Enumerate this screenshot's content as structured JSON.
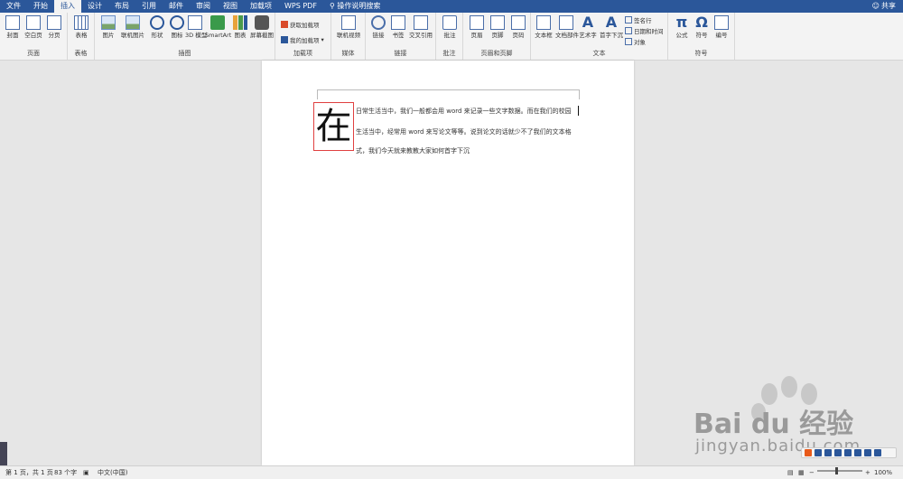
{
  "tabs": [
    "文件",
    "开始",
    "插入",
    "设计",
    "布局",
    "引用",
    "邮件",
    "审阅",
    "视图",
    "加载项",
    "WPS PDF",
    "操作说明搜索"
  ],
  "active_tab": "插入",
  "share_label": "共享",
  "ribbon": {
    "groups": {
      "pages": {
        "label": "页面",
        "buttons": [
          "封面",
          "空白页",
          "分页"
        ]
      },
      "tables": {
        "label": "表格",
        "buttons": [
          "表格"
        ]
      },
      "illustrations": {
        "label": "插图",
        "buttons": [
          "图片",
          "联机图片",
          "形状",
          "图标",
          "3D 模型",
          "SmartArt",
          "图表",
          "屏幕截图"
        ]
      },
      "addins": {
        "label": "加载项",
        "buttons": [
          "获取加载项",
          "我的加载项"
        ]
      },
      "media": {
        "label": "媒体",
        "buttons": [
          "联机视频"
        ]
      },
      "links": {
        "label": "链接",
        "buttons": [
          "链接",
          "书签",
          "交叉引用"
        ]
      },
      "comments": {
        "label": "批注",
        "buttons": [
          "批注"
        ]
      },
      "header_footer": {
        "label": "页眉和页脚",
        "buttons": [
          "页眉",
          "页脚",
          "页码"
        ]
      },
      "text": {
        "label": "文本",
        "buttons": [
          "文本框",
          "文档部件",
          "艺术字",
          "首字下沉"
        ],
        "small": [
          "签名行",
          "日期和时间",
          "对象"
        ]
      },
      "symbols": {
        "label": "符号",
        "buttons": [
          "公式",
          "符号",
          "编号"
        ]
      }
    }
  },
  "document": {
    "dropcap": "在",
    "lines": [
      "日常生活当中，我们一般都会用 word 来记录一些文字数据。而在我们的校园",
      "生活当中，经常用 word 来写论文等等。说到论文的话就少不了我们的文本格",
      "式，我们今天就来教教大家如何首字下沉"
    ]
  },
  "status": {
    "page": "第 1 页，共 1 页",
    "words": "83 个字",
    "language": "中文(中国)",
    "zoom": "100%"
  },
  "watermark": {
    "main": "Bai du 经验",
    "sub": "jingyan.baidu.com"
  },
  "colors": {
    "title_bar": "#2b579a",
    "dropcap_border": "#e04040"
  }
}
